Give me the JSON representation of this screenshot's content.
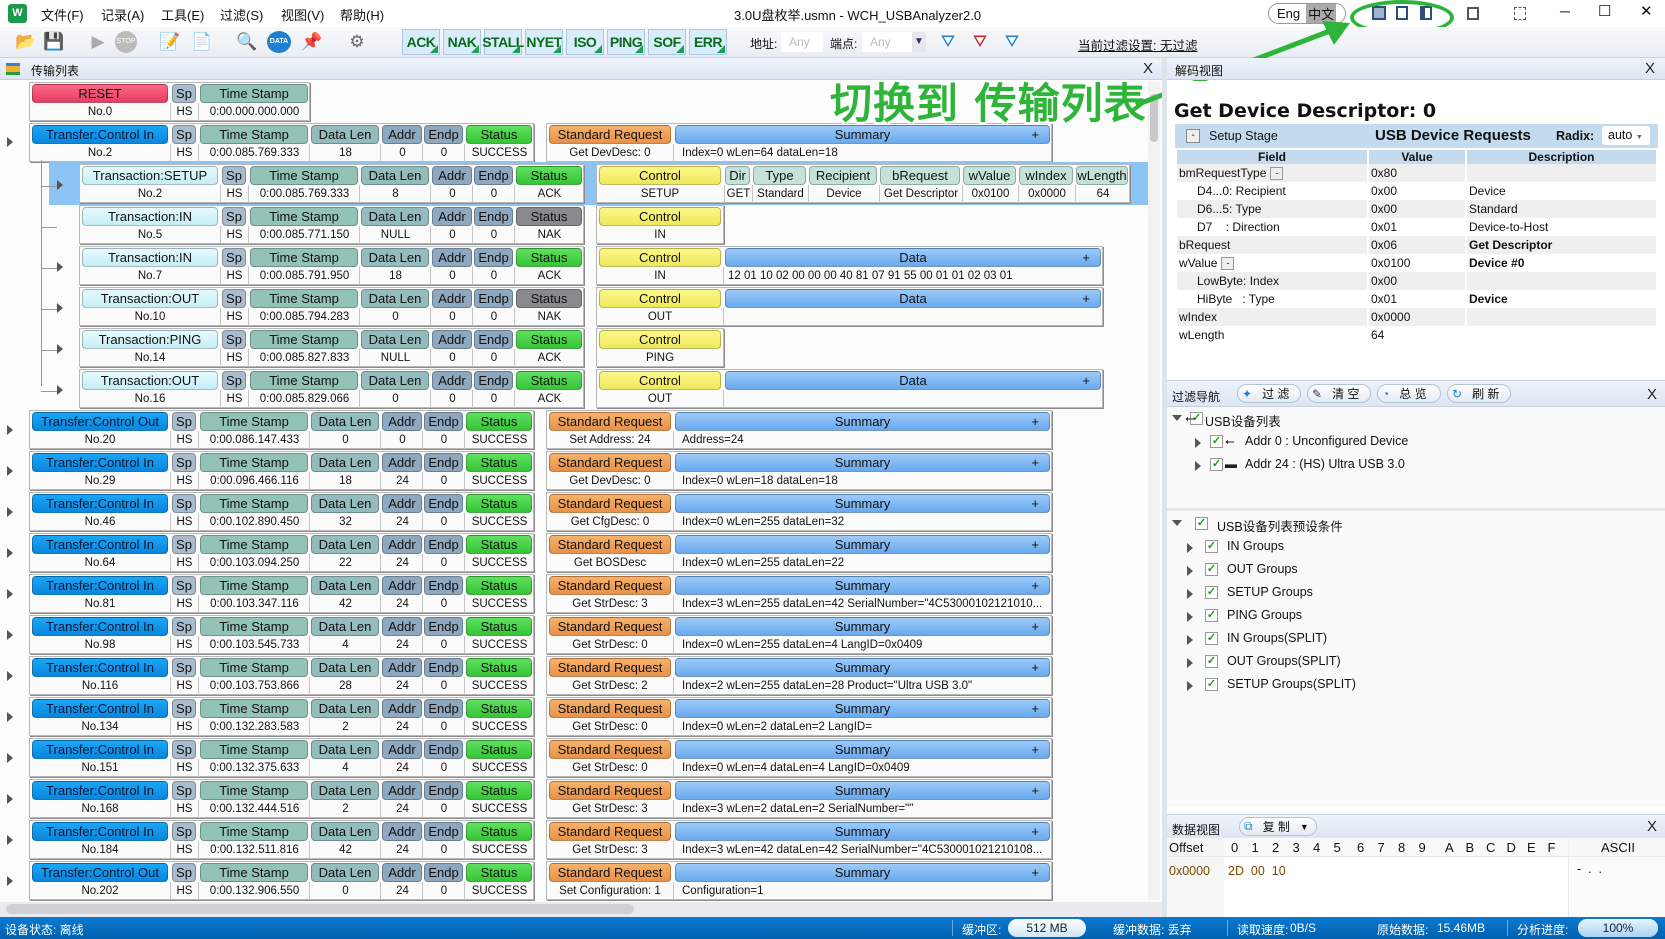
{
  "app": {
    "title": "3.0U盘枚举.usmn - WCH_USBAnalyzer2.0",
    "menus": [
      "文件(F)",
      "记录(A)",
      "工具(E)",
      "过滤(S)",
      "视图(V)",
      "帮助(H)"
    ],
    "lang": [
      "Eng",
      "中文"
    ],
    "window_buttons": [
      "─",
      "☐",
      "✕"
    ]
  },
  "toolbar": {
    "filters": [
      "ACK",
      "NAK",
      "STALL",
      "NYET",
      "ISO",
      "PING",
      "SOF",
      "ERR"
    ],
    "addr_label": "地址:",
    "addr_value": "Any",
    "endp_label": "端点:",
    "endp_value": "Any",
    "current_filter": "当前过滤设置: 无过滤"
  },
  "annotation": {
    "text": "切换到 传输列表",
    "color": "#2fb43a"
  },
  "transfer_panel": {
    "title": "传输列表",
    "close": "X",
    "headers": {
      "sp": "Sp",
      "ts": "Time Stamp",
      "dl": "Data Len",
      "addr": "Addr",
      "endp": "Endp",
      "status": "Status",
      "req": "Standard Request",
      "summary": "Summary",
      "plus": "+",
      "control": "Control",
      "data": "Data",
      "dir": "Dir",
      "type": "Type",
      "recipient": "Recipient",
      "brequest": "bRequest",
      "wvalue": "wValue",
      "windex": "wIndex",
      "wlength": "wLength"
    },
    "reset": {
      "name": "RESET",
      "no": "No.0",
      "sp": "HS",
      "ts": "0:00.000.000.000"
    },
    "expanded_transfer": {
      "name": "Transfer:Control In",
      "no": "No.2",
      "sp": "HS",
      "ts": "0:00.085.769.333",
      "dl": "18",
      "addr": "0",
      "endp": "0",
      "status": "SUCCESS",
      "req_val": "Get DevDesc: 0",
      "summary": "Index=0  wLen=64  dataLen=18"
    },
    "transactions": [
      {
        "name": "Transaction:SETUP",
        "no": "No.2",
        "sp": "HS",
        "ts": "0:00.085.769.333",
        "dl": "8",
        "addr": "0",
        "endp": "0",
        "status": "ACK",
        "pid": "SETUP",
        "kind": "setup",
        "selected": true,
        "setup": {
          "dir": "GET",
          "type": "Standard",
          "recipient": "Device",
          "brequest": "Get Descriptor",
          "wvalue": "0x0100",
          "windex": "0x0000",
          "wlength": "64"
        }
      },
      {
        "name": "Transaction:IN",
        "no": "No.5",
        "sp": "HS",
        "ts": "0:00.085.771.150",
        "dl": "NULL",
        "addr": "0",
        "endp": "0",
        "status": "NAK",
        "pid": "IN",
        "kind": "none"
      },
      {
        "name": "Transaction:IN",
        "no": "No.7",
        "sp": "HS",
        "ts": "0:00.085.791.950",
        "dl": "18",
        "addr": "0",
        "endp": "0",
        "status": "ACK",
        "pid": "IN",
        "kind": "data",
        "data": "12 01 10 02 00 00 00 40 81 07 91 55 00 01 01 02 03 01"
      },
      {
        "name": "Transaction:OUT",
        "no": "No.10",
        "sp": "HS",
        "ts": "0:00.085.794.283",
        "dl": "0",
        "addr": "0",
        "endp": "0",
        "status": "NAK",
        "pid": "OUT",
        "kind": "data",
        "data": ""
      },
      {
        "name": "Transaction:PING",
        "no": "No.14",
        "sp": "HS",
        "ts": "0:00.085.827.833",
        "dl": "NULL",
        "addr": "0",
        "endp": "0",
        "status": "ACK",
        "pid": "PING",
        "kind": "none"
      },
      {
        "name": "Transaction:OUT",
        "no": "No.16",
        "sp": "HS",
        "ts": "0:00.085.829.066",
        "dl": "0",
        "addr": "0",
        "endp": "0",
        "status": "ACK",
        "pid": "OUT",
        "kind": "data",
        "data": ""
      }
    ],
    "transfers": [
      {
        "name": "Transfer:Control Out",
        "no": "No.20",
        "sp": "HS",
        "ts": "0:00.086.147.433",
        "dl": "0",
        "addr": "0",
        "endp": "0",
        "status": "SUCCESS",
        "req_val": "Set Address: 24",
        "summary": "Address=24"
      },
      {
        "name": "Transfer:Control In",
        "no": "No.29",
        "sp": "HS",
        "ts": "0:00.096.466.116",
        "dl": "18",
        "addr": "24",
        "endp": "0",
        "status": "SUCCESS",
        "req_val": "Get DevDesc: 0",
        "summary": "Index=0  wLen=18  dataLen=18"
      },
      {
        "name": "Transfer:Control In",
        "no": "No.46",
        "sp": "HS",
        "ts": "0:00.102.890.450",
        "dl": "32",
        "addr": "24",
        "endp": "0",
        "status": "SUCCESS",
        "req_val": "Get CfgDesc: 0",
        "summary": "Index=0  wLen=255  dataLen=32"
      },
      {
        "name": "Transfer:Control In",
        "no": "No.64",
        "sp": "HS",
        "ts": "0:00.103.094.250",
        "dl": "22",
        "addr": "24",
        "endp": "0",
        "status": "SUCCESS",
        "req_val": "Get BOSDesc",
        "summary": "Index=0  wLen=255  dataLen=22"
      },
      {
        "name": "Transfer:Control In",
        "no": "No.81",
        "sp": "HS",
        "ts": "0:00.103.347.116",
        "dl": "42",
        "addr": "24",
        "endp": "0",
        "status": "SUCCESS",
        "req_val": "Get StrDesc: 3",
        "summary": "Index=3  wLen=255  dataLen=42  SerialNumber=\"4C53000102121010..."
      },
      {
        "name": "Transfer:Control In",
        "no": "No.98",
        "sp": "HS",
        "ts": "0:00.103.545.733",
        "dl": "4",
        "addr": "24",
        "endp": "0",
        "status": "SUCCESS",
        "req_val": "Get StrDesc: 0",
        "summary": "Index=0  wLen=255  dataLen=4  LangID=0x0409"
      },
      {
        "name": "Transfer:Control In",
        "no": "No.116",
        "sp": "HS",
        "ts": "0:00.103.753.866",
        "dl": "28",
        "addr": "24",
        "endp": "0",
        "status": "SUCCESS",
        "req_val": "Get StrDesc: 2",
        "summary": "Index=2  wLen=255  dataLen=28  Product=\"Ultra USB 3.0\""
      },
      {
        "name": "Transfer:Control In",
        "no": "No.134",
        "sp": "HS",
        "ts": "0:00.132.283.583",
        "dl": "2",
        "addr": "24",
        "endp": "0",
        "status": "SUCCESS",
        "req_val": "Get StrDesc: 0",
        "summary": "Index=0  wLen=2  dataLen=2  LangID="
      },
      {
        "name": "Transfer:Control In",
        "no": "No.151",
        "sp": "HS",
        "ts": "0:00.132.375.633",
        "dl": "4",
        "addr": "24",
        "endp": "0",
        "status": "SUCCESS",
        "req_val": "Get StrDesc: 0",
        "summary": "Index=0  wLen=4  dataLen=4  LangID=0x0409"
      },
      {
        "name": "Transfer:Control In",
        "no": "No.168",
        "sp": "HS",
        "ts": "0:00.132.444.516",
        "dl": "2",
        "addr": "24",
        "endp": "0",
        "status": "SUCCESS",
        "req_val": "Get StrDesc: 3",
        "summary": "Index=3  wLen=2  dataLen=2  SerialNumber=\"\""
      },
      {
        "name": "Transfer:Control In",
        "no": "No.184",
        "sp": "HS",
        "ts": "0:00.132.511.816",
        "dl": "42",
        "addr": "24",
        "endp": "0",
        "status": "SUCCESS",
        "req_val": "Get StrDesc: 3",
        "summary": "Index=3  wLen=42  dataLen=42  SerialNumber=\"4C530001021210108..."
      },
      {
        "name": "Transfer:Control Out",
        "no": "No.202",
        "sp": "HS",
        "ts": "0:00.132.906.550",
        "dl": "0",
        "addr": "24",
        "endp": "0",
        "status": "SUCCESS",
        "req_val": "Set Configuration: 1",
        "summary": "Configuration=1"
      }
    ]
  },
  "decode_panel": {
    "title": "解码视图",
    "close": "X",
    "heading": "Get Device Descriptor: 0",
    "stage": "Setup Stage",
    "section": "USB Device Requests",
    "radix_label": "Radix:",
    "radix_value": "auto",
    "columns": [
      "Field",
      "Value",
      "Description"
    ],
    "rows": [
      {
        "field": "bmRequestType",
        "value": "0x80",
        "desc": "",
        "collapse": true,
        "indent": false,
        "bold": false
      },
      {
        "field": "D4...0: Recipient",
        "value": "0x00",
        "desc": "Device",
        "indent": true,
        "bold": false
      },
      {
        "field": "D6...5: Type",
        "value": "0x00",
        "desc": "Standard",
        "indent": true,
        "bold": false
      },
      {
        "field": "D7    : Direction",
        "value": "0x01",
        "desc": "Device-to-Host",
        "indent": true,
        "bold": false
      },
      {
        "field": "bRequest",
        "value": "0x06",
        "desc": "Get Descriptor",
        "indent": false,
        "bold": true
      },
      {
        "field": "wValue",
        "value": "0x0100",
        "desc": "Device #0",
        "collapse": true,
        "indent": false,
        "bold": true
      },
      {
        "field": "LowByte: Index",
        "value": "0x00",
        "desc": "",
        "indent": true,
        "bold": false
      },
      {
        "field": "HiByte   : Type",
        "value": "0x01",
        "desc": "Device",
        "indent": true,
        "bold": true
      },
      {
        "field": "wIndex",
        "value": "0x0000",
        "desc": "",
        "indent": false,
        "bold": false
      },
      {
        "field": "wLength",
        "value": "64",
        "desc": "",
        "indent": false,
        "bold": false
      }
    ]
  },
  "filter_nav": {
    "title": "过滤导航",
    "buttons": [
      "过 滤",
      "清 空",
      "总 览",
      "刷 新"
    ],
    "close": "X",
    "device_tree": {
      "label": "USB设备列表",
      "children": [
        "Addr 0 : Unconfigured Device",
        "Addr 24 : (HS) Ultra USB 3.0"
      ]
    },
    "preset_tree": {
      "label": "USB设备列表预设条件",
      "children": [
        "IN Groups",
        "OUT Groups",
        "SETUP Groups",
        "PING Groups",
        "IN Groups(SPLIT)",
        "OUT Groups(SPLIT)",
        "SETUP Groups(SPLIT)"
      ]
    }
  },
  "data_view": {
    "title": "数据视图",
    "copy": "复 制",
    "close": "X",
    "offset_label": "Offset",
    "hex_cols": [
      "0",
      "1",
      "2",
      "3",
      "4",
      "5",
      "6",
      "7",
      "8",
      "9",
      "A",
      "B",
      "C",
      "D",
      "E",
      "F"
    ],
    "ascii_label": "ASCII",
    "rows": [
      {
        "offset": "0x0000",
        "hex": "2D  00  10",
        "ascii": "-  .  ."
      }
    ]
  },
  "statusbar": {
    "device_state": "设备状态: 离线",
    "buffer_label": "缓冲区:",
    "buffer_value": "512 MB",
    "buffer_data": "缓冲数据: 丢弃",
    "read_speed_label": "读取速度:",
    "read_speed": "0B/S",
    "raw_label": "原始数据:",
    "raw_value": "15.46MB",
    "progress_label": "分析进度:",
    "progress_value": "100%",
    "progress": 100
  }
}
